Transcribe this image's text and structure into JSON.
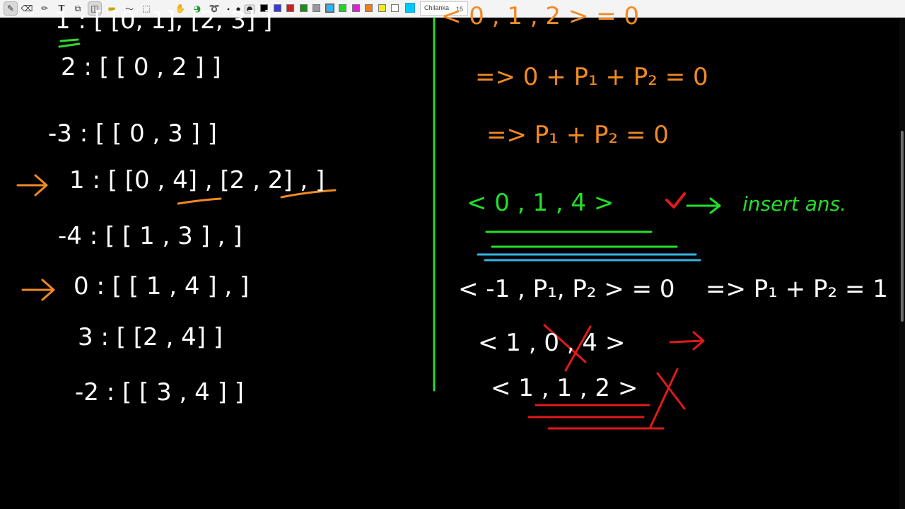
{
  "toolbar": {
    "tools": [
      {
        "name": "pen-tool-icon",
        "glyph": "✎",
        "active": true
      },
      {
        "name": "eraser-tool-icon",
        "glyph": "⌫",
        "active": false
      },
      {
        "name": "highlighter-tool-icon",
        "glyph": "✏",
        "active": false
      },
      {
        "name": "text-tool-icon",
        "glyph": "T",
        "active": false
      },
      {
        "name": "stamp-tool-icon",
        "glyph": "⧉",
        "active": false
      },
      {
        "name": "shapes-tool-icon",
        "glyph": "◫",
        "active": true
      },
      {
        "name": "ruler-tool-icon",
        "glyph": "▬",
        "active": false
      },
      {
        "name": "pen-thickness-tool-icon",
        "glyph": "〜",
        "active": false
      },
      {
        "name": "select-tool-icon",
        "glyph": "⬚",
        "active": false
      },
      {
        "name": "hand-tool-icon",
        "glyph": "✋",
        "active": false
      },
      {
        "name": "color-picker-tool-icon",
        "glyph": "◕",
        "active": false
      },
      {
        "name": "lasso-tool-icon",
        "glyph": "➰",
        "active": false
      }
    ],
    "colors": [
      "#000000",
      "#3b3bd4",
      "#d11f1f",
      "#1e8c1e",
      "#9a9a9a",
      "#29b6f6",
      "#22d422",
      "#e01fd6",
      "#f07d1a",
      "#f4ea1a",
      "#ffffff"
    ],
    "current_color": "#00c8ff",
    "font_name": "Chilanka",
    "font_size": "15"
  },
  "board": {
    "left_lines": [
      {
        "text": "1 : [ [0, 1], [2, 3] ]",
        "color": "#ffffff"
      },
      {
        "text": "2 :  [ [ 0 , 2 ] ]",
        "color": "#ffffff"
      },
      {
        "text": "-3 :  [ [ 0 , 3 ] ]",
        "color": "#ffffff"
      },
      {
        "text": "1 :  [ [0 , 4] , [2 , 2] , ]",
        "color": "#ffffff"
      },
      {
        "text": "-4 :  [ [ 1 , 3 ] , ]",
        "color": "#ffffff"
      },
      {
        "text": "0 :  [ [ 1 , 4 ] , ]",
        "color": "#ffffff"
      },
      {
        "text": "3 :  [ [2 , 4] ]",
        "color": "#ffffff"
      },
      {
        "text": "-2 :  [ [ 3 , 4 ] ]",
        "color": "#ffffff"
      }
    ],
    "right_lines": [
      {
        "text": "< 0 , 1 , 2 >    =  0",
        "color": "#f08a24"
      },
      {
        "text": "=>   0 + P₁ + P₂    =  0",
        "color": "#f08a24"
      },
      {
        "text": "=>      P₁ + P₂ = 0",
        "color": "#f08a24"
      },
      {
        "text": "< 0 ,  1 ,  4 >",
        "color": "#22e02a"
      },
      {
        "text": "insert ans.",
        "color": "#22e02a"
      },
      {
        "text": "< -1 , P₁, P₂ >  = 0",
        "color": "#ffffff"
      },
      {
        "text": "=>  P₁ + P₂ = 1",
        "color": "#ffffff"
      },
      {
        "text": "< 1 , 0 , 4 >",
        "color": "#ffffff"
      },
      {
        "text": "< 1 , 1 , 2 >",
        "color": "#ffffff"
      }
    ],
    "colors": {
      "ink_white": "#ffffff",
      "ink_orange": "#f08a24",
      "ink_green": "#22e02a",
      "ink_red": "#e01a1a",
      "ink_blue": "#35b5e6",
      "divider": "#2ed82e"
    }
  }
}
